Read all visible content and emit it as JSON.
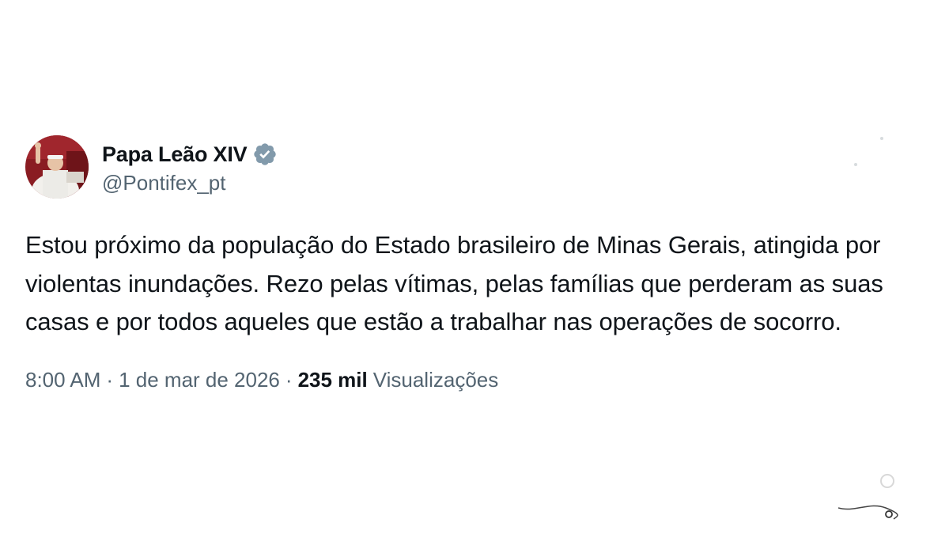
{
  "author": {
    "display_name": "Papa Leão XIV",
    "handle": "@Pontifex_pt",
    "verified": true,
    "badge_color": "#829aab"
  },
  "tweet": {
    "text": "Estou próximo da população do Estado brasileiro de Minas Gerais, atingida por violentas inundações. Rezo pelas vítimas, pelas famílias que perderam as suas casas e por todos aqueles que estão a trabalhar nas operações de socorro."
  },
  "meta": {
    "time": "8:00 AM",
    "separator": "·",
    "date": "1 de mar de 2026",
    "views_count": "235 mil",
    "views_label": "Visualizações"
  },
  "icons": {
    "avatar": "avatar-image",
    "badge": "verified-badge-icon",
    "watermark": "grok-swirl-icon"
  },
  "colors": {
    "text_primary": "#0f1419",
    "text_secondary": "#536471",
    "background": "#ffffff"
  }
}
